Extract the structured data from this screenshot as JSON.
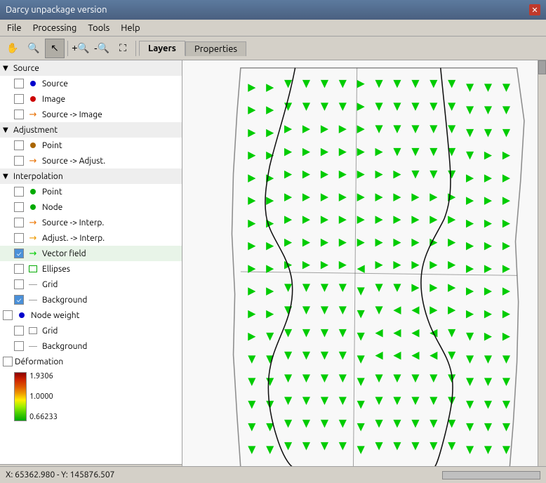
{
  "app": {
    "title": "Darcy unpackage version"
  },
  "menubar": {
    "items": [
      "File",
      "Processing",
      "Tools",
      "Help"
    ]
  },
  "toolbar": {
    "tabs": [
      "Layers",
      "Properties"
    ]
  },
  "layers": {
    "title": "Layers",
    "sections": [
      {
        "id": "source-section",
        "label": "Source",
        "expanded": true,
        "items": [
          {
            "id": "source-item",
            "label": "Source",
            "checked": false,
            "dot_color": "#0000cc"
          },
          {
            "id": "image-item",
            "label": "Image",
            "checked": false,
            "dot_color": "#cc0000"
          },
          {
            "id": "source-image-item",
            "label": "Source -> Image",
            "checked": false,
            "type": "arrow"
          }
        ]
      },
      {
        "id": "adjustment-section",
        "label": "Adjustment",
        "expanded": true,
        "items": [
          {
            "id": "adj-point-item",
            "label": "Point",
            "checked": false,
            "dot_color": "#aa6600"
          },
          {
            "id": "adj-source-item",
            "label": "Source -> Adjust.",
            "checked": false,
            "type": "arrow"
          }
        ]
      },
      {
        "id": "interpolation-section",
        "label": "Interpolation",
        "expanded": true,
        "items": [
          {
            "id": "interp-point-item",
            "label": "Point",
            "checked": false,
            "dot_color": "#00aa00"
          },
          {
            "id": "interp-node-item",
            "label": "Node",
            "checked": false,
            "dot_color": "#00aa00"
          },
          {
            "id": "source-interp-item",
            "label": "Source -> Interp.",
            "checked": false,
            "type": "arrow",
            "color": "#ee7700"
          },
          {
            "id": "adjust-interp-item",
            "label": "Adjust. -> Interp.",
            "checked": false,
            "type": "arrow",
            "color": "#ee9900"
          },
          {
            "id": "vector-field-item",
            "label": "Vector field",
            "checked": true,
            "type": "arrow",
            "color": "#00cc00"
          },
          {
            "id": "ellipses-item",
            "label": "Ellipses",
            "checked": false,
            "type": "rect",
            "color": "#00aa00"
          },
          {
            "id": "grid-item",
            "label": "Grid",
            "checked": false,
            "type": "line",
            "color": "#888888"
          },
          {
            "id": "background-item",
            "label": "Background",
            "checked": true,
            "type": "line",
            "color": "#888888"
          }
        ]
      },
      {
        "id": "nodeweight-section",
        "label": "Node weight",
        "items": [
          {
            "id": "nw-item",
            "label": "Node weight",
            "checked": false,
            "dot_color": "#0000cc"
          }
        ],
        "extra_items": [
          {
            "id": "nw-grid-item",
            "label": "Grid",
            "checked": false,
            "type": "rect"
          },
          {
            "id": "nw-bg-item",
            "label": "Background",
            "checked": false,
            "type": "line"
          }
        ]
      },
      {
        "id": "deformation-section",
        "label": "Déformation",
        "colorbar": {
          "top_value": "1.9306",
          "mid_value": "1.0000",
          "bot_value": "0.66233"
        }
      }
    ]
  },
  "bottom": {
    "up_label": "▲",
    "down_label": "▼",
    "coords": "X: 65362.980 - Y: 145876.507"
  }
}
